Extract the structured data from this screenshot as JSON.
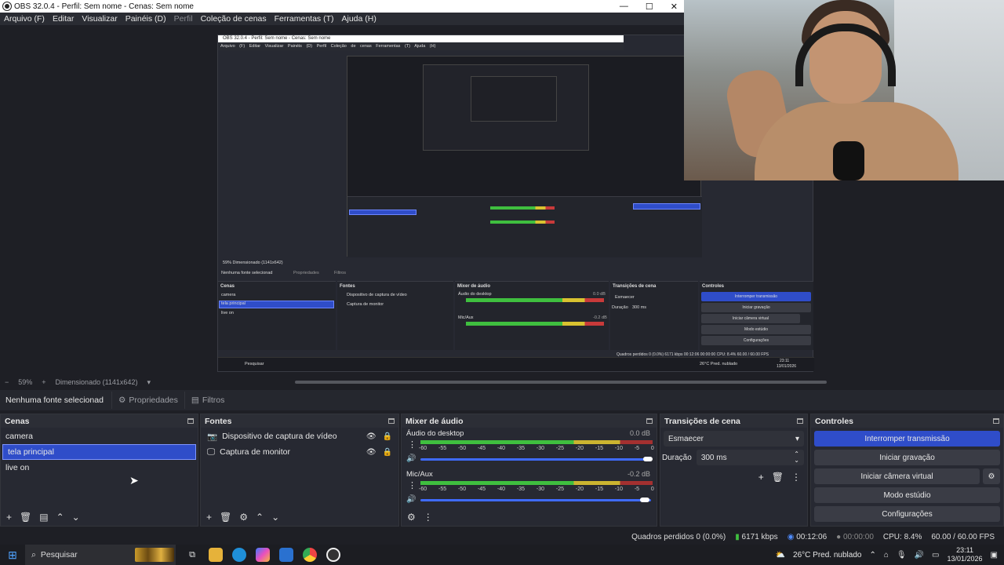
{
  "titlebar": {
    "title": "OBS 32.0.4 - Perfil: Sem nome - Cenas: Sem nome",
    "minimize": "—",
    "maximize": "☐",
    "close": "✕"
  },
  "menu": [
    "Arquivo (F)",
    "Editar",
    "Visualizar",
    "Painéis (D)",
    "Perfil",
    "Coleção de cenas",
    "Ferramentas (T)",
    "Ajuda (H)"
  ],
  "zoom": {
    "minus": "−",
    "value": "59%",
    "plus": "+",
    "scale": "Dimensionado (1141x642)"
  },
  "propbar": {
    "label": "Nenhuma fonte selecionad",
    "properties": "Propriedades",
    "filters": "Filtros"
  },
  "scenes": {
    "title": "Cenas",
    "items": [
      "camera",
      "tela principal",
      "live on"
    ],
    "selected": 1
  },
  "sources": {
    "title": "Fontes",
    "items": [
      {
        "icon": "camera-icon",
        "label": "Dispositivo de captura de vídeo"
      },
      {
        "icon": "monitor-icon",
        "label": "Captura de monitor"
      }
    ]
  },
  "mixer": {
    "title": "Mixer de áudio",
    "ticks": [
      "-60",
      "-55",
      "-50",
      "-45",
      "-40",
      "-35",
      "-30",
      "-25",
      "-20",
      "-15",
      "-10",
      "-5",
      "0"
    ],
    "channels": [
      {
        "name": "Áudio do desktop",
        "db": "0.0 dB",
        "level": 1.0
      },
      {
        "name": "Mic/Aux",
        "db": "-0.2 dB",
        "level": 0.98
      }
    ]
  },
  "transitions": {
    "title": "Transições de cena",
    "selected": "Esmaecer",
    "duration_label": "Duração",
    "duration_value": "300 ms"
  },
  "controls": {
    "title": "Controles",
    "buttons": [
      "Interromper transmissão",
      "Iniciar gravação",
      "Iniciar câmera virtual",
      "Modo estúdio",
      "Configurações"
    ]
  },
  "status": {
    "dropped": "Quadros perdidos 0 (0.0%)",
    "bitrate": "6171 kbps",
    "live_time": "00:12:06",
    "rec_time": "00:00:00",
    "cpu": "CPU: 8.4%",
    "fps": "60.00 / 60.00 FPS"
  },
  "taskbar": {
    "search": "Pesquisar",
    "weather": "26°C  Pred. nublado",
    "time": "23:11",
    "date": "13/01/2026"
  },
  "nested": {
    "title": "OBS 32.0.4 - Perfil: Sem nome - Cenas: Sem nome",
    "menu": "Arquivo (F)  Editar  Visualizar  Painéis (D)  Perfil  Coleção de cenas  Ferramentas (T)  Ajuda (H)",
    "zoom": "59%    Dimensionado (1141x642)",
    "nosource": "Nenhuma fonte selecionad",
    "props": "Propriedades",
    "filters": "Filtros",
    "scenes_title": "Cenas",
    "scenes": [
      "camera",
      "tela principal",
      "live on"
    ],
    "sources_title": "Fontes",
    "sources": [
      "Dispositivo de captura de vídeo",
      "Captura de monitor"
    ],
    "mixer_title": "Mixer de áudio",
    "ch1": "Áudio do desktop",
    "ch1_db": "0.0 dB",
    "ch2": "Mic/Aux",
    "ch2_db": "-0.2 dB",
    "trans_title": "Transições de cena",
    "trans": "Esmaecer",
    "dur_label": "Duração",
    "dur": "300 ms",
    "ctl_title": "Controles",
    "ctl": [
      "Interromper transmissão",
      "Iniciar gravação",
      "Iniciar câmera virtual",
      "Modo estúdio",
      "Configurações"
    ],
    "status": "Quadros perdidos 0 (0.0%)   6171 kbps   00:12:06   00:00:00   CPU: 8.4%   60.00 / 60.00 FPS",
    "search": "Pesquisar",
    "weather": "26°C  Pred. nublado",
    "time": "23:11",
    "date": "13/01/2026"
  },
  "colors": {
    "accent": "#2f4dc9",
    "bg": "#1e1f25",
    "panel": "#272932"
  }
}
